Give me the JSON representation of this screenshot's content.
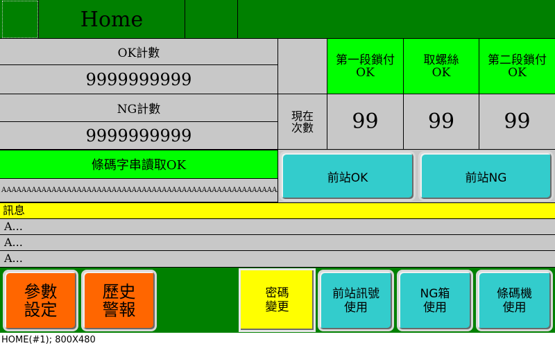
{
  "header": {
    "title": "Home"
  },
  "counters": {
    "ok_label": "OK計數",
    "ok_value": "9999999999",
    "ng_label": "NG計數",
    "ng_value": "9999999999"
  },
  "barcode": {
    "status": "條碼字串讀取OK",
    "string": "AAAAAAAAAAAAAAAAAAAAAAAAAAAAAAAAAAAAAAAAAAAAAAAAAAAAAAAAAAAAAAAAAAAAAAAAAAAAAAAAAAAAAAAAA"
  },
  "stations": {
    "row_label": "現在\n次數",
    "items": [
      {
        "name": "第一段鎖付\nOK",
        "count": "99"
      },
      {
        "name": "取螺絲\nOK",
        "count": "99"
      },
      {
        "name": "第二段鎖付\nOK",
        "count": "99"
      }
    ]
  },
  "prev_station": {
    "ok_label": "前站OK",
    "ng_label": "前站NG"
  },
  "messages": {
    "header": "訊息",
    "lines": [
      "A...",
      "A...",
      "A..."
    ]
  },
  "bottom_buttons": {
    "params": "參數\n設定",
    "history": "歷史\n警報",
    "password": "密碼\n變更",
    "prev_signal": "前站訊號\n使用",
    "ng_box": "NG箱\n使用",
    "barcode_machine": "條碼機\n使用"
  },
  "status_bar": {
    "text": "HOME(#1); 800X480"
  },
  "colors": {
    "frame_green": "#008000",
    "status_green": "#00ff00",
    "panel_gray": "#c8c8c8",
    "message_yellow": "#ffff00",
    "button_cyan": "#33cccc",
    "button_orange": "#ff6600"
  }
}
